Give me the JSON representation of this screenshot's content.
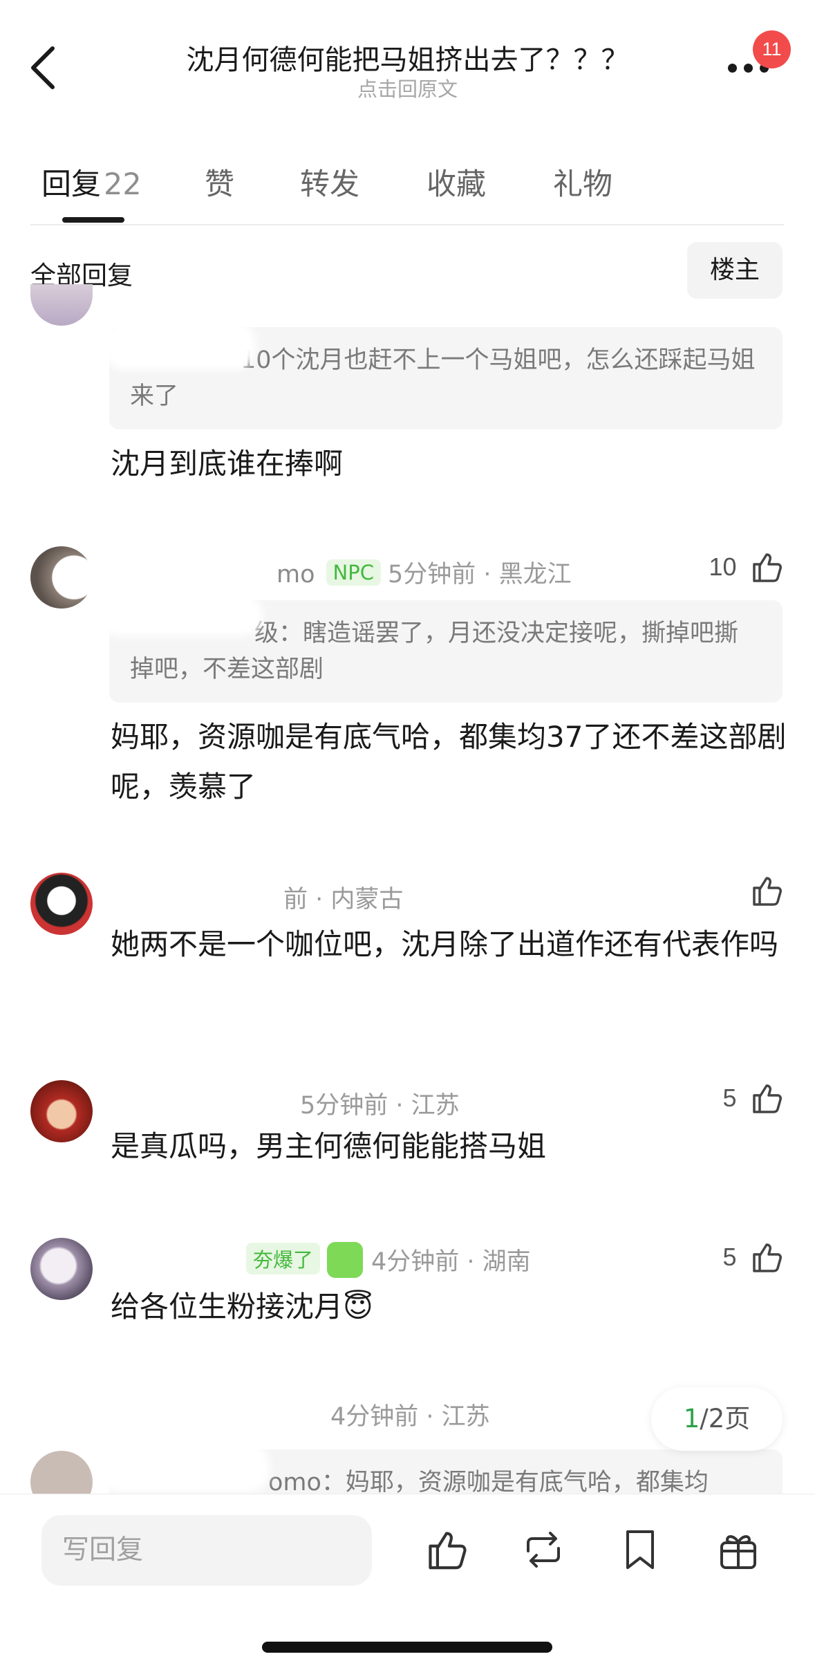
{
  "header": {
    "title": "沈月何德何能把马姐挤出去了？？？",
    "subtitle": "点击回原文",
    "notification_count": "11"
  },
  "tabs": [
    {
      "label": "回复",
      "count": "22",
      "active": true
    },
    {
      "label": "赞"
    },
    {
      "label": "转发"
    },
    {
      "label": "收藏"
    },
    {
      "label": "礼物"
    }
  ],
  "filter": {
    "label": "全部回复",
    "op_button": "楼主"
  },
  "comments": [
    {
      "quote": "10个沈月也赶不上一个马姐吧，怎么还踩起马姐来了",
      "body": "沈月到底谁在捧啊"
    },
    {
      "username_suffix": "mo",
      "tag": "NPC",
      "time_location": "5分钟前 · 黑龙江",
      "likes": "10",
      "quote": "级：瞎造谣罢了，月还没决定接呢，撕掉吧撕掉吧，不差这部剧",
      "body": "妈耶，资源咖是有底气哈，都集均37了还不差这部剧呢，羡慕了"
    },
    {
      "time_location": "前 · 内蒙古",
      "likes": "",
      "body": "她两不是一个咖位吧，沈月除了出道作还有代表作吗"
    },
    {
      "time_location": "5分钟前 · 江苏",
      "likes": "5",
      "body": "是真瓜吗，男主何德何能能搭马姐"
    },
    {
      "tag": "夯爆了",
      "time_location": "4分钟前 · 湖南",
      "likes": "5",
      "body": "给各位生粉接沈月😇"
    },
    {
      "time_location": "4分钟前 · 江苏",
      "quote": "omo：妈耶，资源咖是有底气哈，都集均"
    }
  ],
  "pager": {
    "current": "1",
    "rest": "/2页"
  },
  "bottom_bar": {
    "placeholder": "写回复"
  },
  "colors": {
    "accent_green": "#43b83c",
    "badge_red": "#f24b4b"
  }
}
